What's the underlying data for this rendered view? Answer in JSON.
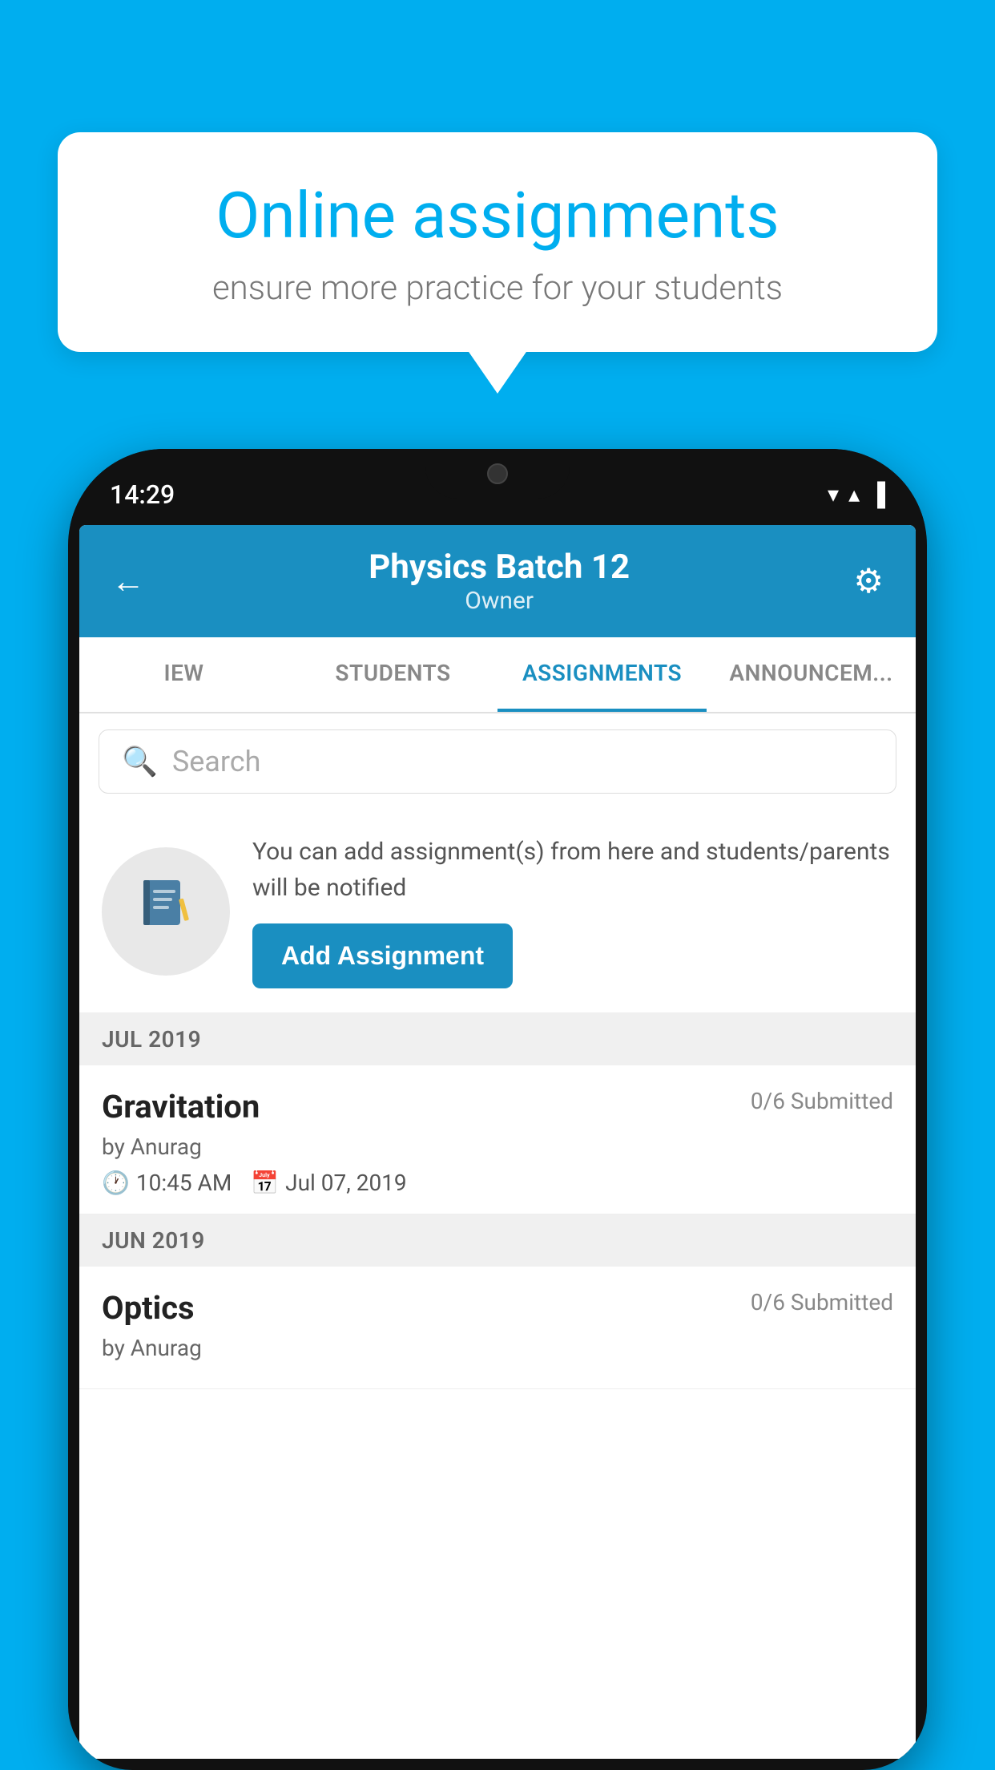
{
  "background_color": "#00AEEF",
  "info_card": {
    "title": "Online assignments",
    "subtitle": "ensure more practice for your students"
  },
  "status_bar": {
    "time": "14:29",
    "wifi": "▼",
    "signal": "▲",
    "battery": "▌"
  },
  "app_header": {
    "title": "Physics Batch 12",
    "subtitle": "Owner",
    "back_icon": "←",
    "gear_icon": "⚙"
  },
  "tabs": [
    {
      "label": "IEW",
      "active": false
    },
    {
      "label": "STUDENTS",
      "active": false
    },
    {
      "label": "ASSIGNMENTS",
      "active": true
    },
    {
      "label": "ANNOUNCEM...",
      "active": false
    }
  ],
  "search": {
    "placeholder": "Search"
  },
  "promo": {
    "icon": "📓",
    "text": "You can add assignment(s) from here and students/parents will be notified",
    "button_label": "Add Assignment"
  },
  "sections": [
    {
      "header": "JUL 2019",
      "assignments": [
        {
          "name": "Gravitation",
          "submitted": "0/6 Submitted",
          "author": "by Anurag",
          "time": "10:45 AM",
          "date": "Jul 07, 2019"
        }
      ]
    },
    {
      "header": "JUN 2019",
      "assignments": [
        {
          "name": "Optics",
          "submitted": "0/6 Submitted",
          "author": "by Anurag",
          "time": "",
          "date": ""
        }
      ]
    }
  ]
}
